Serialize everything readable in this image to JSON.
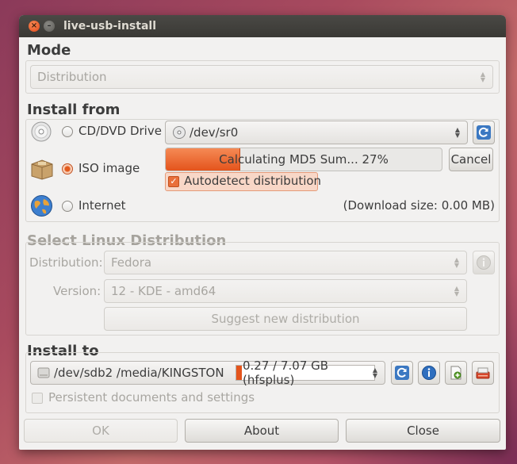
{
  "window": {
    "title": "live-usb-install"
  },
  "mode": {
    "title": "Mode",
    "selected": "Distribution"
  },
  "install_from": {
    "title": "Install from",
    "cd": {
      "label": "CD/DVD Drive",
      "device": "/dev/sr0"
    },
    "iso": {
      "label": "ISO image",
      "progress_text": "Calculating MD5 Sum... 27%",
      "progress_percent": 27,
      "cancel_label": "Cancel",
      "autodetect_label": "Autodetect distribution",
      "autodetect_checked": true
    },
    "internet": {
      "label": "Internet",
      "download_size": "(Download size: 0.00 MB)"
    },
    "selected_source": "iso"
  },
  "select_distribution": {
    "title": "Select Linux Distribution",
    "distribution_label": "Distribution:",
    "distribution_value": "Fedora",
    "version_label": "Version:",
    "version_value": "12 - KDE - amd64",
    "suggest_label": "Suggest new distribution"
  },
  "install_to": {
    "title": "Install to",
    "device": "/dev/sdb2 /media/KINGSTON",
    "usage": "0.27 / 7.07 GB (hfsplus)",
    "usage_fraction": 0.038,
    "persistent_label": "Persistent documents and settings",
    "persistent_checked": false
  },
  "footer": {
    "ok_label": "OK",
    "about_label": "About",
    "close_label": "Close"
  },
  "colors": {
    "accent": "#e4541c",
    "window_bg": "#f2f1f0",
    "titlebar": "#3c3b37"
  }
}
